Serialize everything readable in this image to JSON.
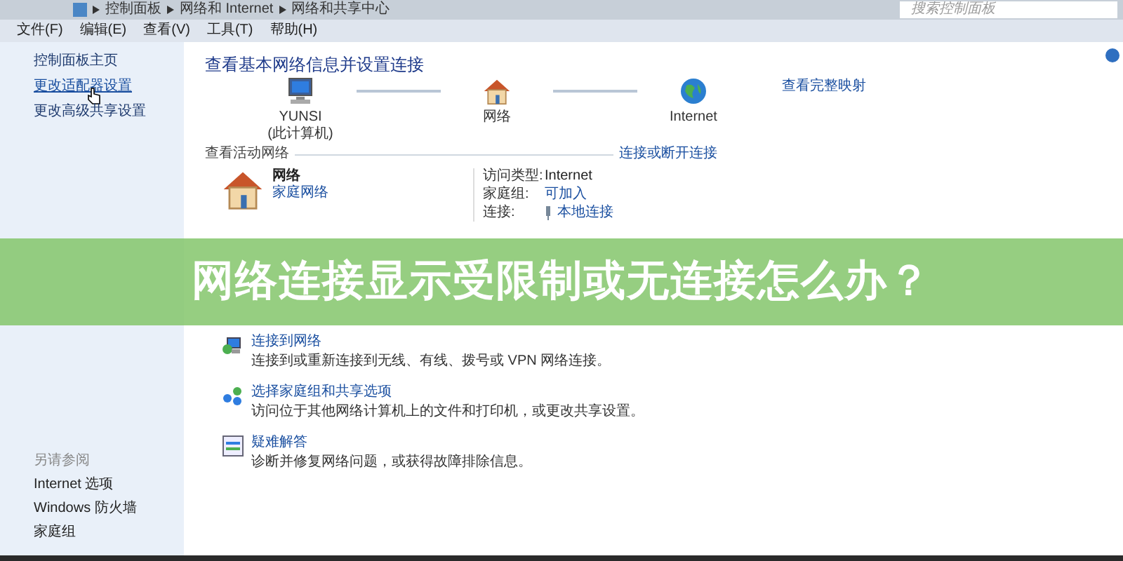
{
  "window": {
    "breadcrumb": [
      "控制面板",
      "网络和 Internet",
      "网络和共享中心"
    ],
    "search": {
      "placeholder": "搜索控制面板"
    }
  },
  "menu": [
    "文件(F)",
    "编辑(E)",
    "查看(V)",
    "工具(T)",
    "帮助(H)"
  ],
  "sidebar": {
    "links": [
      {
        "label": "控制面板主页",
        "hovered": false
      },
      {
        "label": "更改适配器设置",
        "hovered": true
      },
      {
        "label": "更改高级共享设置",
        "hovered": false
      }
    ],
    "see_also": {
      "heading": "另请参阅",
      "links": [
        "Internet 选项",
        "Windows 防火墙",
        "家庭组"
      ]
    }
  },
  "main": {
    "title": "查看基本网络信息并设置连接",
    "map": {
      "nodes": [
        {
          "kind": "computer",
          "label": "YUNSI",
          "sublabel": "(此计算机)"
        },
        {
          "kind": "network",
          "label": "网络"
        },
        {
          "kind": "internet",
          "label": "Internet"
        }
      ],
      "link": "查看完整映射"
    },
    "active_networks": {
      "heading": "查看活动网络",
      "action": "连接或断开连接",
      "network": {
        "name": "网络",
        "type": "家庭网络"
      },
      "properties": [
        {
          "label": "访问类型:",
          "value": "Internet",
          "kind": "text"
        },
        {
          "label": "家庭组:",
          "value": "可加入",
          "kind": "link"
        },
        {
          "label": "连接:",
          "value": "本地连接",
          "kind": "connection"
        }
      ]
    },
    "settings": {
      "tasks": [
        {
          "title": "连接到网络",
          "description": "连接到或重新连接到无线、有线、拨号或 VPN 网络连接。"
        },
        {
          "title": "选择家庭组和共享选项",
          "description": "访问位于其他网络计算机上的文件和打印机，或更改共享设置。"
        },
        {
          "title": "疑难解答",
          "description": "诊断并修复网络问题，或获得故障排除信息。"
        }
      ]
    }
  },
  "banner": {
    "title": "网络连接显示受限制或无连接怎么办？"
  }
}
